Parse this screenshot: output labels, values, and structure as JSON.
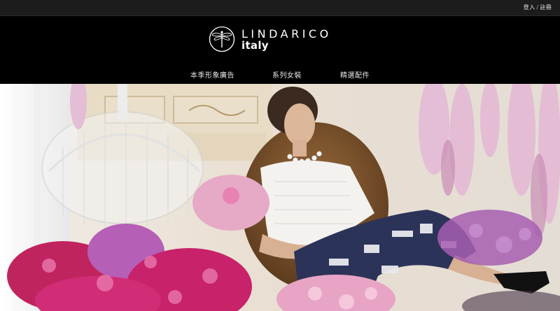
{
  "topbar": {
    "login_label": "登入",
    "separator": "/",
    "register_label": "註冊"
  },
  "brand": {
    "name": "LINDARICO",
    "subtitle": "italy",
    "logo_icon": "dragonfly-icon"
  },
  "nav": {
    "items": [
      {
        "label": "本季形象廣告"
      },
      {
        "label": "系列女裝"
      },
      {
        "label": "精選配件"
      }
    ]
  },
  "hero": {
    "description_icon": "hero-photo"
  },
  "colors": {
    "topbar_bg": "#1c1c1c",
    "header_bg": "#000000",
    "text": "#ffffff"
  }
}
